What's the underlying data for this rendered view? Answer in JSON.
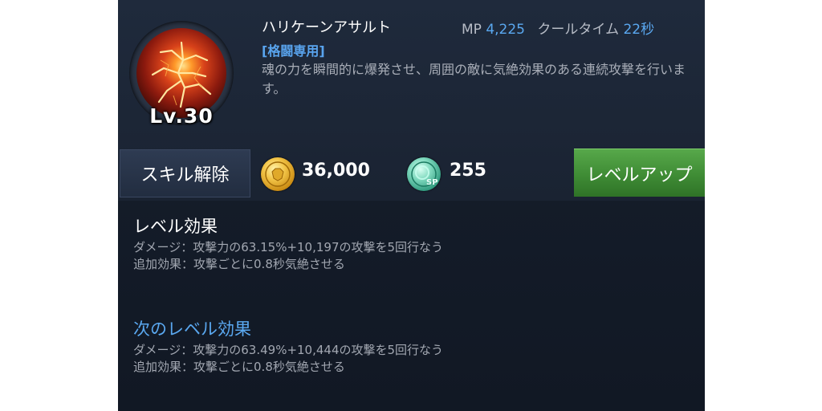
{
  "skill": {
    "name": "ハリケーンアサルト",
    "tag": "[格闘専用]",
    "description": "魂の力を瞬間的に爆発させ、周囲の敵に気絶効果のある連続攻撃を行います。",
    "level_label": "Lv.30",
    "icon": "lightning-burst-icon"
  },
  "stats": {
    "mp_label": "MP",
    "mp_value": "4,225",
    "cooldown_label": "クールタイム",
    "cooldown_value": "22秒"
  },
  "actions": {
    "release_label": "スキル解除",
    "levelup_label": "レベルアップ",
    "gold_cost": "36,000",
    "gold_icon": "gold-coin-icon",
    "sp_cost": "255",
    "sp_icon": "sp-coin-icon"
  },
  "current_effect": {
    "title": "レベル効果",
    "lines": [
      "ダメージ：攻撃力の63.15%+10,197の攻撃を5回行なう",
      "追加効果：攻撃ごとに0.8秒気絶させる"
    ]
  },
  "next_effect": {
    "title": "次のレベル効果",
    "lines": [
      "ダメージ：攻撃力の63.49%+10,444の攻撃を5回行なう",
      "追加効果：攻撃ごとに0.8秒気絶させる"
    ]
  },
  "colors": {
    "accent_blue": "#5aa8f0",
    "levelup_green": "#4a9a3f",
    "panel_bg": "#1a2332"
  }
}
